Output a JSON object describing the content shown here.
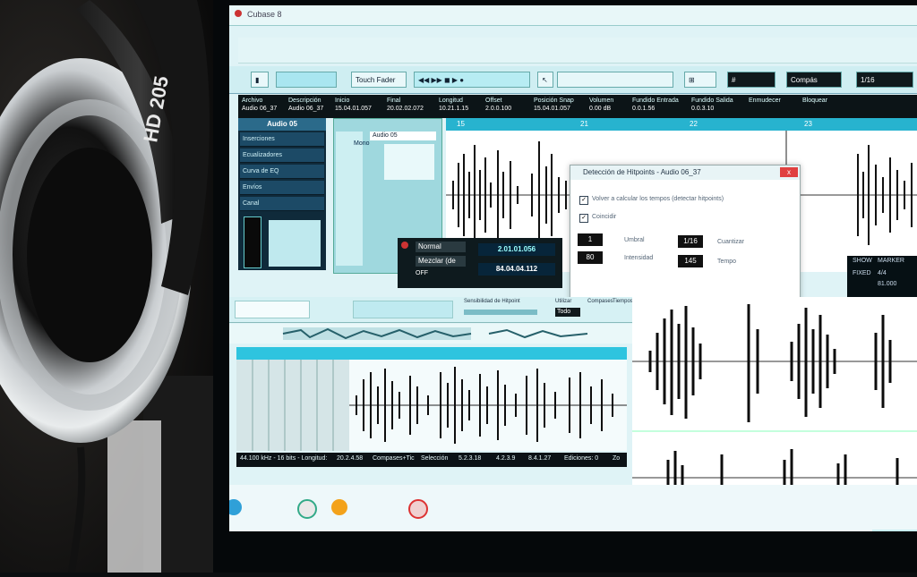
{
  "headphones": {
    "model_text": "HD 205"
  },
  "window": {
    "title": "Cubase 8"
  },
  "toolbar": {
    "touch_fader": "Touch Fader",
    "compas": "Compás",
    "quantize": "1/16"
  },
  "infobar": {
    "columns": [
      {
        "label": "Archivo",
        "value": "Audio 06_37"
      },
      {
        "label": "Descripción",
        "value": "Audio 06_37"
      },
      {
        "label": "Inicio",
        "value": "15.04.01.057"
      },
      {
        "label": "Final",
        "value": "20.02.02.072"
      },
      {
        "label": "Longitud",
        "value": "10.21.1.15"
      },
      {
        "label": "Offset",
        "value": "2.0.0.100"
      },
      {
        "label": "Posición Snap",
        "value": "15.04.01.057"
      },
      {
        "label": "Volumen",
        "value": "0.00 dB"
      },
      {
        "label": "Fundido Entrada",
        "value": "0.0.1.56"
      },
      {
        "label": "Fundido Salida",
        "value": "0.0.3.10"
      },
      {
        "label": "Enmudecer",
        "value": ""
      },
      {
        "label": "Bloquear",
        "value": ""
      }
    ]
  },
  "inspector": {
    "title": "Audio 05",
    "items": [
      "Inserciones",
      "Ecualizadores",
      "Curva de EQ",
      "Envíos",
      "Canal"
    ]
  },
  "mixer": {
    "label": "Mono",
    "channel": "Audio 05"
  },
  "ruler": {
    "marks": [
      "15",
      "21",
      "22",
      "23"
    ]
  },
  "dialog": {
    "title": "Detección de Hitpoints - Audio 06_37",
    "options": [
      "Volver a calcular los tempos (detectar hitpoints)",
      "Coincidir"
    ],
    "fields": [
      {
        "value": "1",
        "label": "Umbral"
      },
      {
        "value": "80",
        "label": "Intensidad"
      },
      {
        "value": "1/16",
        "label": "Cuantizar"
      },
      {
        "value": "145",
        "label": "Tempo"
      }
    ],
    "close": "x"
  },
  "transport": {
    "mode1": "Normal",
    "mode2": "Mezclar (de",
    "off": "OFF",
    "time1": "2.01.01.056",
    "time2": "84.04.04.112"
  },
  "keypad": {
    "labels": [
      "SHOW",
      "MARKER"
    ],
    "fixed": "FIXED",
    "sig": "4/4",
    "value": "81.000"
  },
  "lower_toolbar": {
    "sensitivity": "Sensibilidad de Hitpoint",
    "use": "Utilizar",
    "use_value": "Todo",
    "compases": "Compases",
    "tiempos": "Tiempos"
  },
  "statusbar": {
    "format": "44.100 kHz - 16 bits - Longitud:",
    "length": "20.2.4.58",
    "compases": "Compases+Tic",
    "seleccion_label": "Selección",
    "sel1": "5.2.3.18",
    "sel2": "4.2.3.9",
    "sel3": "8.4.1.27",
    "ediciones": "Ediciones: 0",
    "zoom": "Zo"
  }
}
